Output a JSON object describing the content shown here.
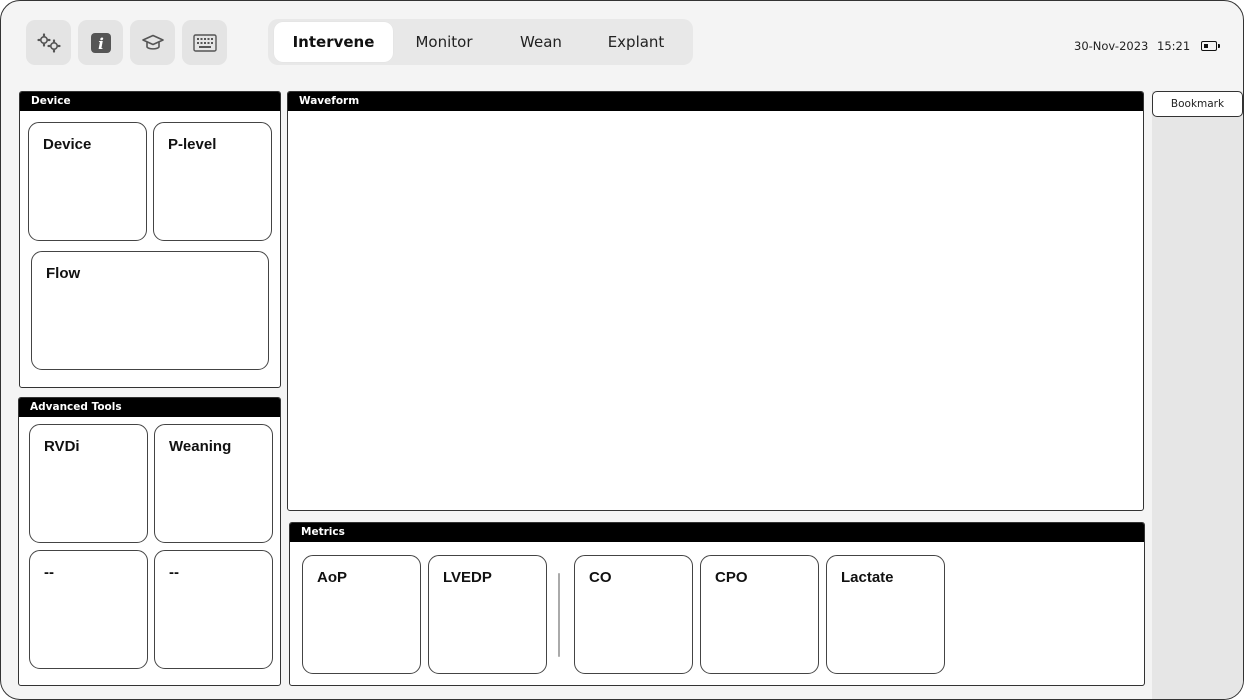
{
  "toolbar": {
    "icons": [
      "gears-icon",
      "info-icon",
      "graduation-cap-icon",
      "keyboard-icon"
    ]
  },
  "tabs": [
    {
      "label": "Intervene",
      "active": true
    },
    {
      "label": "Monitor",
      "active": false
    },
    {
      "label": "Wean",
      "active": false
    },
    {
      "label": "Explant",
      "active": false
    }
  ],
  "status": {
    "date": "30-Nov-2023",
    "time": "15:21",
    "battery_icon": "battery-icon"
  },
  "device_panel": {
    "title": "Device",
    "cards": [
      "Device",
      "P-level",
      "Flow"
    ]
  },
  "advanced_panel": {
    "title": "Advanced Tools",
    "cards": [
      "RVDi",
      "Weaning",
      "--",
      "--"
    ]
  },
  "waveform_panel": {
    "title": "Waveform"
  },
  "metrics_panel": {
    "title": "Metrics",
    "cards": [
      "AoP",
      "LVEDP",
      "CO",
      "CPO",
      "Lactate"
    ]
  },
  "sidebar": {
    "bookmark_label": "Bookmark"
  }
}
